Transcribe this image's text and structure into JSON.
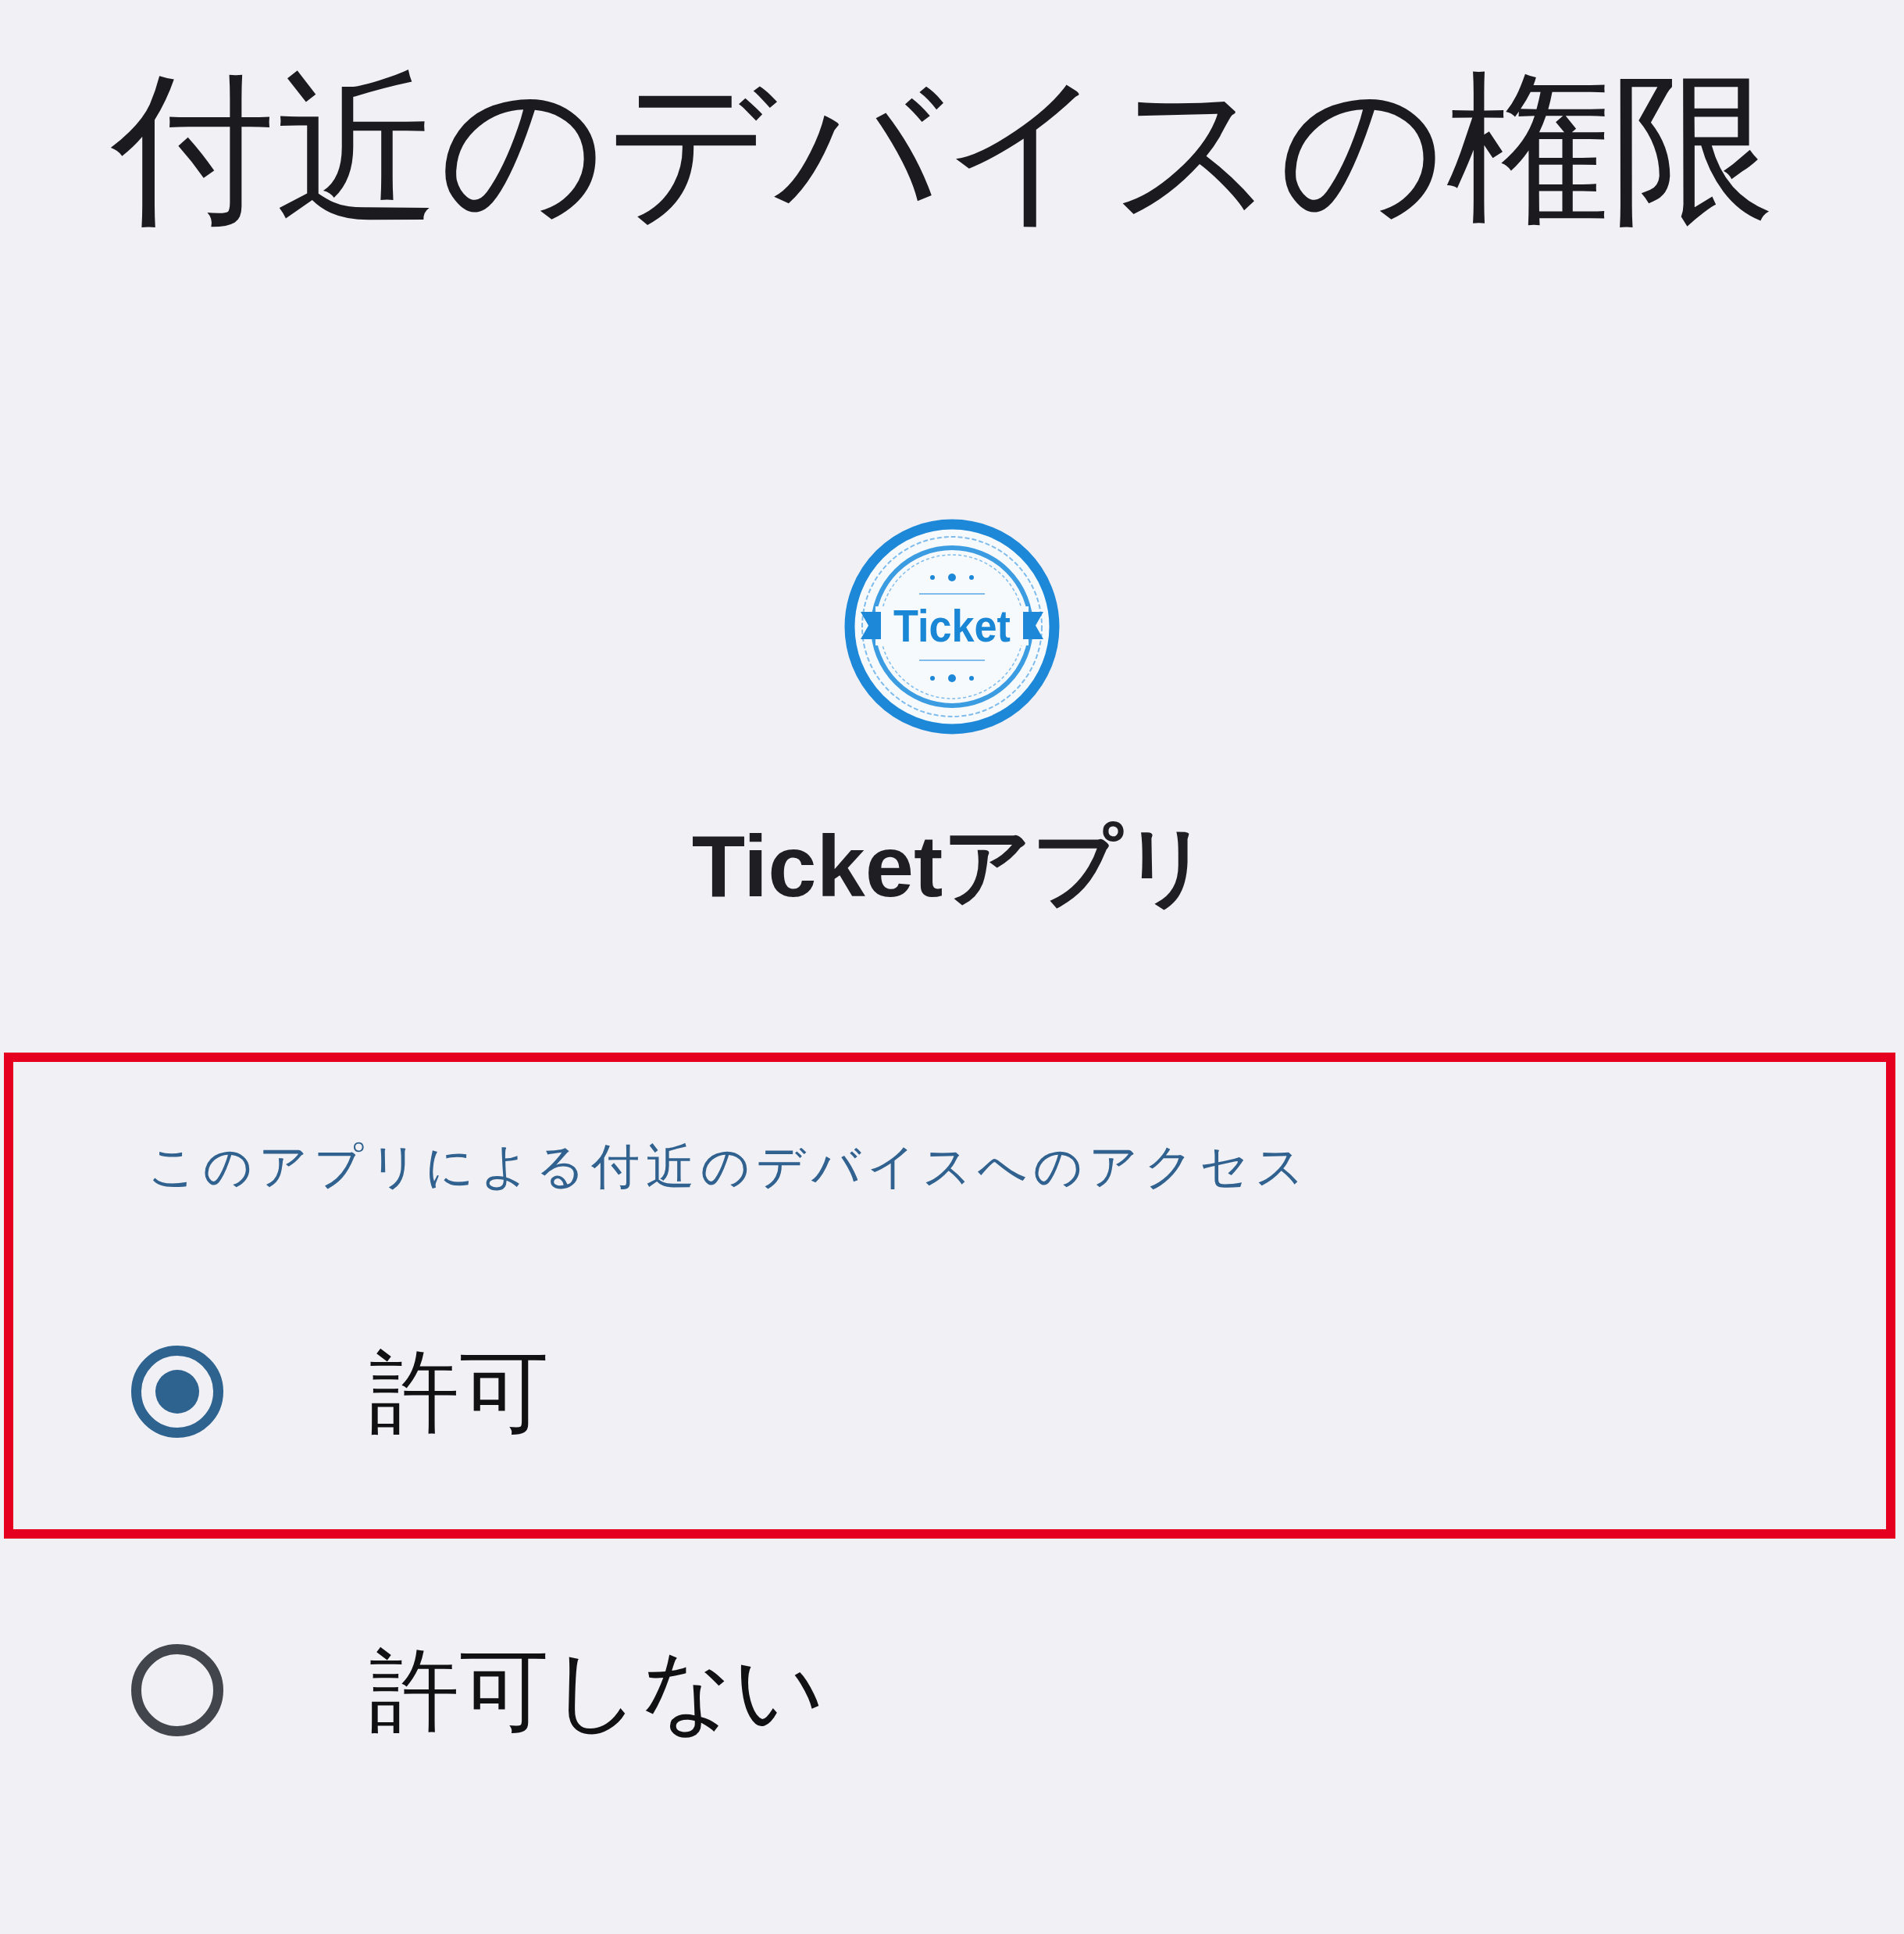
{
  "screen": {
    "title": "付近のデバイスの権限"
  },
  "app": {
    "logo_text": "Ticket",
    "name": "Ticketアプリ"
  },
  "access": {
    "heading": "このアプリによる付近のデバイスへのアクセス",
    "heading_highlighted": true,
    "options": [
      {
        "label": "許可",
        "selected": true,
        "highlighted": true
      },
      {
        "label": "許可しない",
        "selected": false,
        "highlighted": false
      }
    ]
  }
}
